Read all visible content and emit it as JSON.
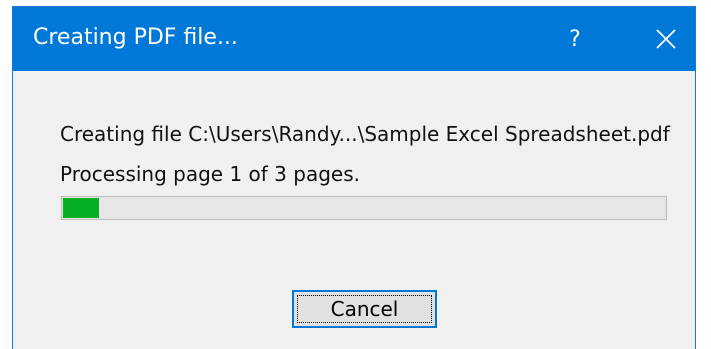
{
  "window": {
    "title": "Creating PDF file...",
    "help_label": "?",
    "close_icon": "close-icon"
  },
  "body": {
    "file_message": "Creating file C:\\Users\\Randy...\\Sample Excel Spreadsheet.pdf",
    "progress_message": "Processing page 1 of 3 pages.",
    "progress_fraction": 0.06
  },
  "actions": {
    "cancel_label": "Cancel"
  },
  "colors": {
    "titlebar": "#0078d7",
    "progress_fill": "#06b025",
    "dialog_background": "#f0f0f0"
  }
}
